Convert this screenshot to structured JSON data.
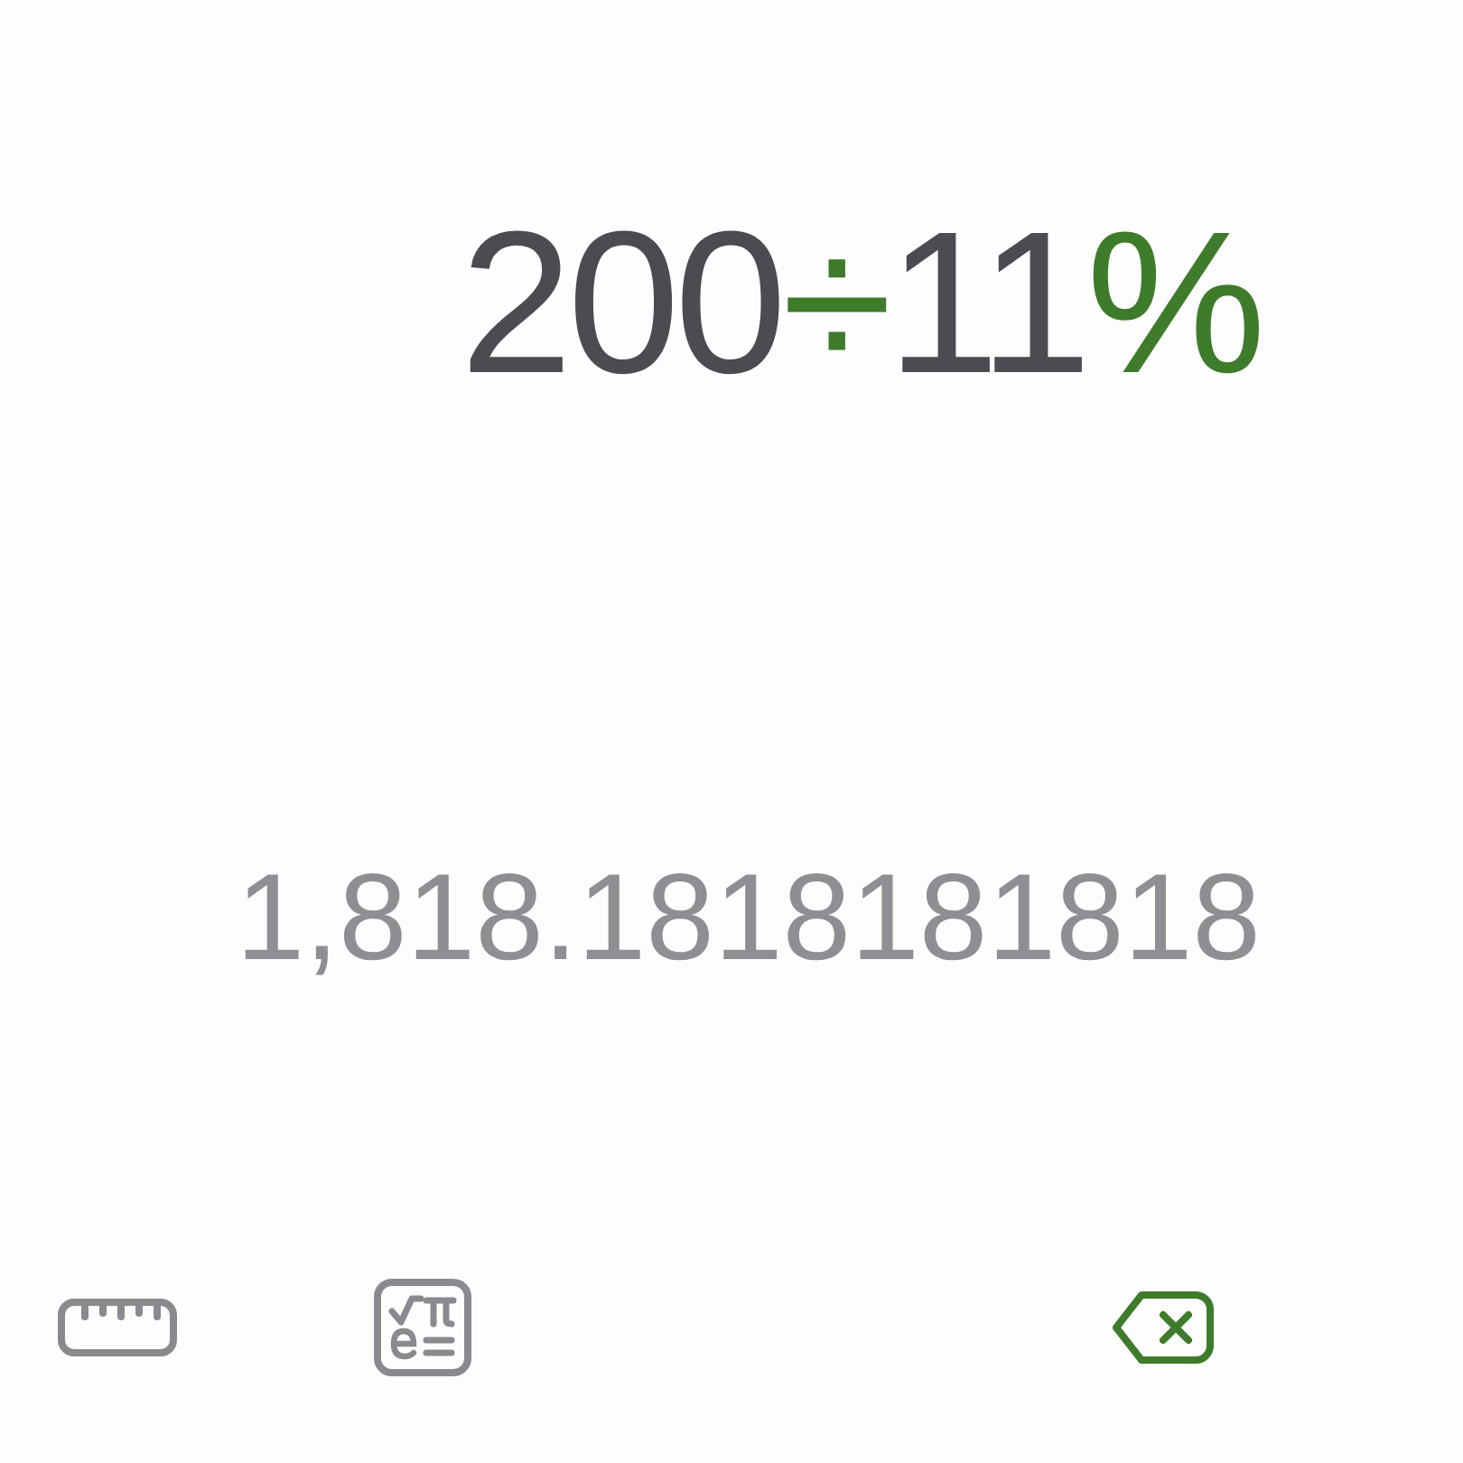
{
  "expression": [
    {
      "text": "200",
      "kind": "number"
    },
    {
      "text": "÷",
      "kind": "operator"
    },
    {
      "text": "11",
      "kind": "number"
    },
    {
      "text": "%",
      "kind": "operator"
    }
  ],
  "result": "1,818.1818181818",
  "toolbar": [
    {
      "kind": "ruler"
    },
    {
      "kind": "scientific"
    },
    {
      "kind": "backspace"
    }
  ]
}
